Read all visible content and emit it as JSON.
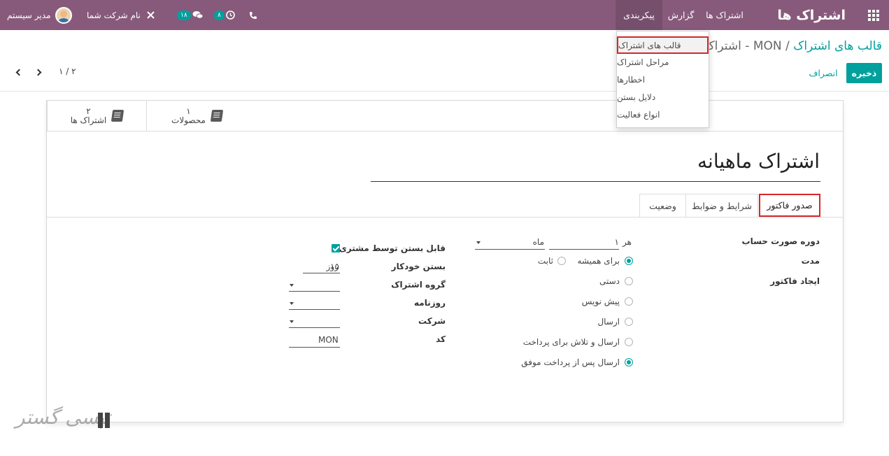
{
  "navbar": {
    "app_title": "اشتراک ها",
    "menu": {
      "subscriptions": "اشتراک ها",
      "reporting": "گزارش",
      "configuration": "پیکربندی"
    },
    "company": "نام شرکت شما",
    "user": "مدیر سیستم",
    "activity_count": "۸",
    "messages_count": "۱۸"
  },
  "dropdown": {
    "items": [
      "قالب های اشتراک",
      "مراحل اشتراک",
      "اخطارها",
      "دلایل بستن",
      "انواع فعالیت"
    ]
  },
  "breadcrumb": {
    "parent": "قالب های اشتراک",
    "separator": "/",
    "current": "MON - اشتراک"
  },
  "actions": {
    "save": "ذخیره",
    "discard": "انصراف"
  },
  "pager": {
    "text": "۲ / ۱"
  },
  "smart_buttons": {
    "products": {
      "count": "۱",
      "label": "محصولات"
    },
    "subscriptions": {
      "count": "۲",
      "label": "اشتراک ها"
    }
  },
  "form": {
    "title": "اشتراک ماهیانه",
    "tabs": {
      "invoicing": "صدور فاکتور",
      "terms": "شرایط و ضوابط",
      "status": "وضعیت"
    },
    "labels": {
      "billing_period": "دوره صورت حساب",
      "duration": "مدت",
      "invoice_creation": "ایجاد فاکتور",
      "customer_closable": "قابل بستن توسط مشتری",
      "auto_close": "بستن خودکار",
      "subscription_group": "گروه اشتراک",
      "journal": "روزنامه",
      "company": "شرکت",
      "code": "کد"
    },
    "billing_every": "هر",
    "billing_value": "۱",
    "billing_unit": "ماه",
    "duration_options": {
      "forever": "برای همیشه",
      "fixed": "ثابت"
    },
    "invoice_options": {
      "manual": "دستی",
      "draft": "پیش نویس",
      "send": "ارسال",
      "send_try_pay": "ارسال و تلاش برای پرداخت",
      "send_after_pay": "ارسال پس از پرداخت موفق"
    },
    "auto_close_value": "۱۵",
    "auto_close_unit": "روز",
    "code_value": "MON"
  },
  "watermark": "تپسی گستر"
}
